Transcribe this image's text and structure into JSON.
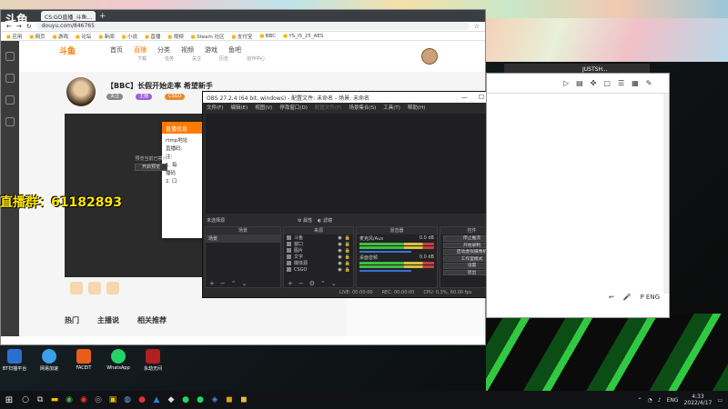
{
  "browser": {
    "logo_text": "斗鱼",
    "tab_label": "CS:GO直播_斗鱼...",
    "newtab": "+",
    "url": "douyu.com/846765",
    "bookmarks": [
      "应用",
      "网页",
      "游戏",
      "论坛",
      "新闻",
      "小说",
      "直播",
      "视频",
      "Steam 社区",
      "支付宝",
      "BBC",
      "YS_I5_25_AES"
    ]
  },
  "site": {
    "logo": "斗鱼",
    "nav": [
      "首页",
      "直播",
      "分类",
      "视频",
      "游戏",
      "鱼吧"
    ],
    "active_nav": "直播",
    "header_icons": [
      "下载",
      "任务",
      "关注",
      "历史",
      "创作中心"
    ],
    "room_title": "【BBC】长假开始走率  希望新手",
    "pills": [
      "关注",
      "主播",
      "CSGO"
    ],
    "bottom_links": [
      "热门",
      "主播说",
      "相关推荐"
    ]
  },
  "dialog": {
    "title": "直播信息",
    "lines": [
      "rtmp地址",
      "直播码:",
      "注:",
      "1. 每",
      "播码",
      "2. 口"
    ]
  },
  "overlay": {
    "qq_group": "直播群：61182893"
  },
  "obs": {
    "title": "OBS 27.2.4 (64 bit, windows) - 配置文件: 未命名 - 场景: 未命名",
    "menu": [
      "文件(F)",
      "编辑(E)",
      "视图(V)",
      "停靠窗口(D)",
      "配置文件(P)",
      "场景集合(S)",
      "工具(T)",
      "帮助(H)"
    ],
    "preview_msg": "预览当前已禁用",
    "preview_btn": "开启预览",
    "no_source": "未选择源",
    "props_btn": "属性",
    "filters_btn": "滤镜",
    "docks": {
      "scenes": "场景",
      "sources": "来源",
      "mixer": "混音器",
      "controls": "控件"
    },
    "scenes": [
      "场景"
    ],
    "sources": [
      "斗鱼",
      "窗口",
      "图片",
      "文字",
      "媒体源",
      "CSGO"
    ],
    "mixer": [
      {
        "name": "麦克风/Aux",
        "db": "0.0 dB"
      },
      {
        "name": "桌面音频",
        "db": "0.0 dB"
      }
    ],
    "controls": [
      "停止推流",
      "开始录制",
      "启动虚拟摄像机",
      "工作室模式",
      "设置",
      "退出"
    ],
    "status": [
      "LIVE: 00:00:00",
      "REC: 00:00:00",
      "CPU: 0.3%, 60.00 fps"
    ]
  },
  "right_window": {
    "tab": "JUSTSH...",
    "status": "P  ENG"
  },
  "desktop_icons": [
    "BT扫描平台",
    "网易加速",
    "FACEIT",
    "WhatsApp",
    "永劫无间"
  ],
  "taskbar": {
    "time": "4:33",
    "date": "2022/4/17",
    "lang": "ENG"
  },
  "colors": {
    "accent": "#ff7a00",
    "obs_bg": "#2b2b2d",
    "qq_text": "#ffe600"
  }
}
